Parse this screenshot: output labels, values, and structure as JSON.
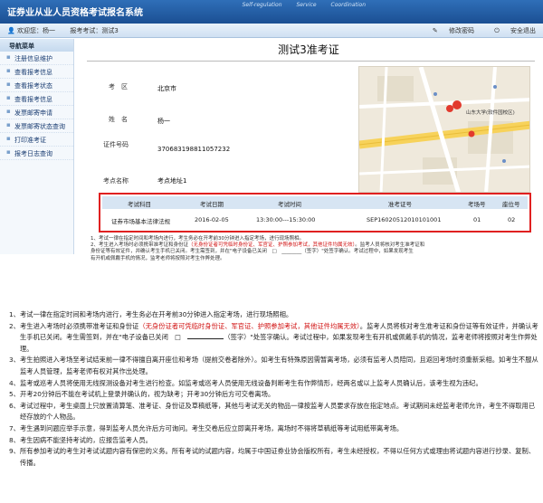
{
  "header": {
    "title": "证券业从业人员资格考试报名系统",
    "slogan": [
      "Self-regulation",
      "Service",
      "Coordination"
    ]
  },
  "userbar": {
    "welcome": "欢迎您：杨一",
    "exam_label": "报考考试：测试3",
    "change_password": "修改密码",
    "logout": "安全退出"
  },
  "sidebar": {
    "heading": "导航菜单",
    "items": [
      {
        "label": "注册信息维护"
      },
      {
        "label": "查看报考信息"
      },
      {
        "label": "查看报考状态"
      },
      {
        "label": "查看报考信息"
      },
      {
        "label": "发票邮寄申请"
      },
      {
        "label": "发票邮寄状态查询"
      },
      {
        "label": "打印准考证"
      },
      {
        "label": "报考日志查询"
      }
    ]
  },
  "certificate": {
    "title": "测试3准考证",
    "fields": {
      "area_label": "考　区",
      "area_value": "北京市",
      "name_label": "姓　名",
      "name_value": "杨一",
      "id_label": "证件号码",
      "id_value": "370683198811057232",
      "site_label": "考点名称",
      "site_value": "考点地址1"
    },
    "map_label": "山东大学(软件园校区)"
  },
  "exam_table": {
    "headers": [
      "考试科目",
      "考试日期",
      "考试时间",
      "准考证号",
      "考场号",
      "座位号"
    ],
    "rows": [
      [
        "证券市场基本法律法规",
        "2016-02-05",
        "13:30:00---15:30:00",
        "SEP16020512010101001",
        "01",
        "02"
      ]
    ]
  },
  "mini_notes": {
    "line1": "1、考试一律在指定时间和考场内进行，考生务必在开考前30分钟进入指定考场，进行现场照相。",
    "line2a": "2、考生进入考场时必须携带准考证和身份证",
    "line2b_red": "（无身份证者可凭临时身份证、军官证、护照参加考试，其他证件均属无效）",
    "line2c": "。监考人员将核对考生准考证和",
    "line3": "身份证等有效证件，并确认考生手机已关闭。考生需签到，并在\"电子设备已关闭　□　________（签字）\"处签字确认。考试过程中，如果发现考生",
    "line4": "有开机或佩戴手机的情况，监考老师将按照对考生作弊处理。"
  },
  "notes": [
    {
      "num": "1、",
      "parts": [
        {
          "t": "考试一律在指定时间和考场内进行，考生务必在开考前30分钟进入指定考场，进行现场照相。"
        }
      ]
    },
    {
      "num": "2、",
      "parts": [
        {
          "t": "考生进入考场时必须携带准考证和身份证"
        },
        {
          "t": "（无身份证者可凭临时身份证、军官证、护照参加考试，其他证件均属无效）",
          "red": true
        },
        {
          "t": "。监考人员将核对考生准考证和身份证等有效证件，并确认考生手机已关闭。考生需签到，并在\"电子设备已关闭　□　"
        },
        {
          "t": "（签字）\"处签字确认。考试过程中，如果发现考生有开机或佩戴手机的情况，监考老师将按照对考生作弊处理。",
          "gap": true
        }
      ]
    },
    {
      "num": "3、",
      "parts": [
        {
          "t": "考生拍照进入考场至考试结束前一律不得擅自离开座位和考场（提前交卷者除外）。如考生有特殊原因需暂离考场，必须有监考人员陪同，且返回考场时须重新采相。如考生不服从监考人员管理，监考老师有权对其作出处理。"
        }
      ]
    },
    {
      "num": "4、",
      "parts": [
        {
          "t": "监考或巡考人员将使用无线探测设备对考生进行检查。如监考或巡考人员使用无线设备判断考生有作弊情形，经两名或以上监考人员确认后，该考生视为违纪。"
        }
      ]
    },
    {
      "num": "5、",
      "parts": [
        {
          "t": "开考20分钟后不能在考试机上登录并确认的，视为缺考；开考30分钟后方可交卷离场。"
        }
      ]
    },
    {
      "num": "6、",
      "parts": [
        {
          "t": "考试过程中，考生桌面上只放置清算笔、准考证、身份证及草稿纸等，其他与考试无关的物品一律按监考人员要求存放在指定地点。考试期间未经监考老师允许，考生不得取用已经存放的个人物品。"
        }
      ]
    },
    {
      "num": "7、",
      "parts": [
        {
          "t": "考生遇到问题应举手示意，得到监考人员允许后方可询问。考生交卷后应立即离开考场，离场时不得将草稿纸等考试用纸带离考场。"
        }
      ]
    },
    {
      "num": "8、",
      "parts": [
        {
          "t": "考生因病不能坚持考试的，应报告监考人员。"
        }
      ]
    },
    {
      "num": "9、",
      "parts": [
        {
          "t": "所有参加考试的考生对考试试题内容有保密的义务。所有考试的试题内容，均属于中国证券业协会版权所有，考生未经授权，不得以任何方式或理由将试题内容进行抄录、复制、传播。"
        }
      ]
    }
  ],
  "colors": {
    "header_blue": "#1b4f93",
    "table_border": "#e02020",
    "warning_red": "#d01010"
  }
}
